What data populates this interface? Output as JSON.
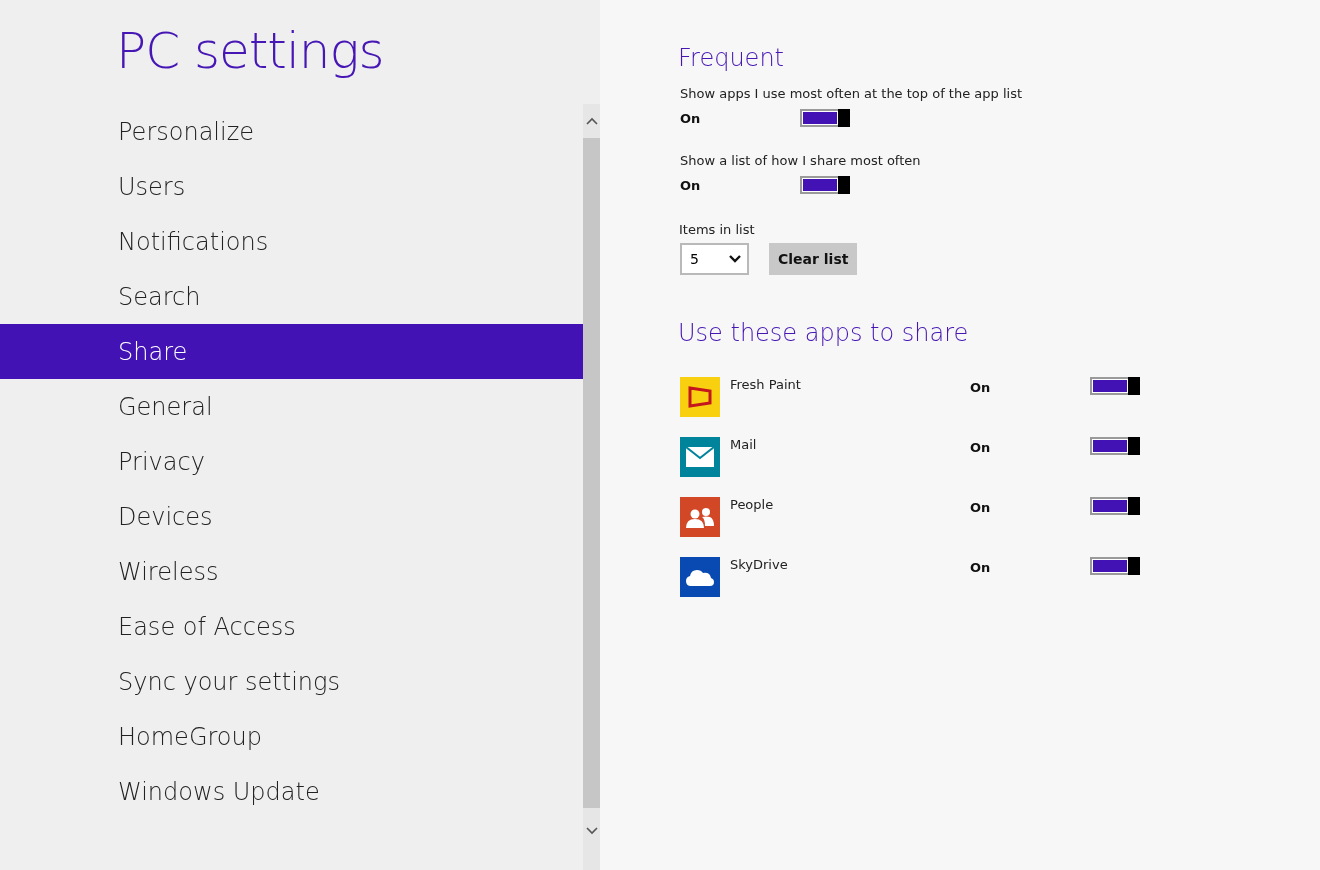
{
  "sidebar": {
    "title": "PC settings",
    "items": [
      {
        "label": "Personalize",
        "selected": false
      },
      {
        "label": "Users",
        "selected": false
      },
      {
        "label": "Notifications",
        "selected": false
      },
      {
        "label": "Search",
        "selected": false
      },
      {
        "label": "Share",
        "selected": true
      },
      {
        "label": "General",
        "selected": false
      },
      {
        "label": "Privacy",
        "selected": false
      },
      {
        "label": "Devices",
        "selected": false
      },
      {
        "label": "Wireless",
        "selected": false
      },
      {
        "label": "Ease of Access",
        "selected": false
      },
      {
        "label": "Sync your settings",
        "selected": false
      },
      {
        "label": "HomeGroup",
        "selected": false
      },
      {
        "label": "Windows Update",
        "selected": false
      }
    ]
  },
  "frequent": {
    "heading": "Frequent",
    "settings": [
      {
        "label": "Show apps I use most often at the top of the app list",
        "state": "On",
        "on": true
      },
      {
        "label": "Show a list of how I share most often",
        "state": "On",
        "on": true
      }
    ],
    "items_label": "Items in list",
    "items_value": "5",
    "clear_button": "Clear list"
  },
  "apps": {
    "heading": "Use these apps to share",
    "items": [
      {
        "name": "Fresh Paint",
        "state": "On",
        "on": true,
        "color": "#f8d010"
      },
      {
        "name": "Mail",
        "state": "On",
        "on": true,
        "color": "#00849c"
      },
      {
        "name": "People",
        "state": "On",
        "on": true,
        "color": "#d24726"
      },
      {
        "name": "SkyDrive",
        "state": "On",
        "on": true,
        "color": "#094ab2"
      }
    ]
  }
}
